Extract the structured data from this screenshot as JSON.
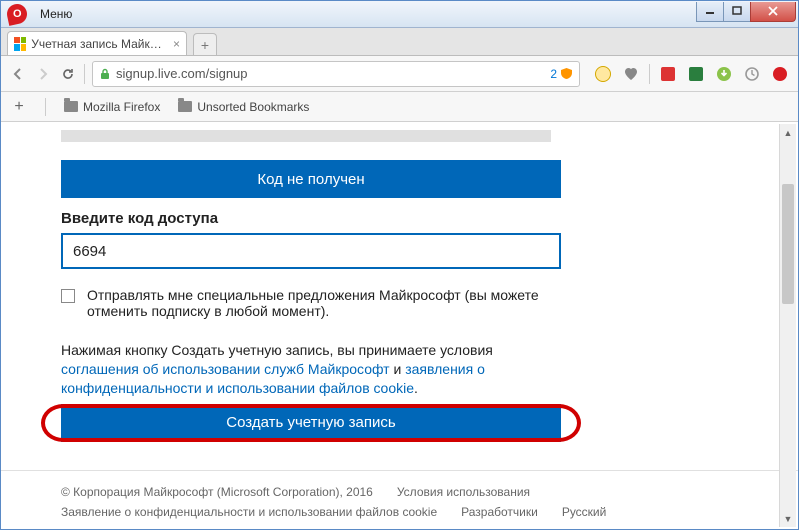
{
  "window": {
    "menu": "Меню"
  },
  "tab": {
    "title": "Учетная запись Майкрософ"
  },
  "url": {
    "text": "signup.live.com/signup",
    "badge_count": "2"
  },
  "bookmarks": {
    "folder1": "Mozilla Firefox",
    "folder2": "Unsorted Bookmarks"
  },
  "page": {
    "btn_no_code": "Код не получен",
    "label_code": "Введите код доступа",
    "code_value": "6694",
    "offers_text": "Отправлять мне специальные предложения Майкрософт (вы можете отменить подписку в любой момент).",
    "tos_prefix": "Нажимая кнопку Создать учетную запись, вы принимаете условия ",
    "tos_link1": "соглашения об использовании служб Майкрософт",
    "tos_and": " и ",
    "tos_link2": "заявления о конфиденциальности и использовании файлов cookie",
    "tos_suffix": ".",
    "btn_create": "Создать учетную запись"
  },
  "footer": {
    "copyright": "© Корпорация Майкрософт (Microsoft Corporation), 2016",
    "link_terms": "Условия использования",
    "link_privacy": "Заявление о конфиденциальности и использовании файлов cookie",
    "link_devs": "Разработчики",
    "link_lang": "Русский"
  }
}
